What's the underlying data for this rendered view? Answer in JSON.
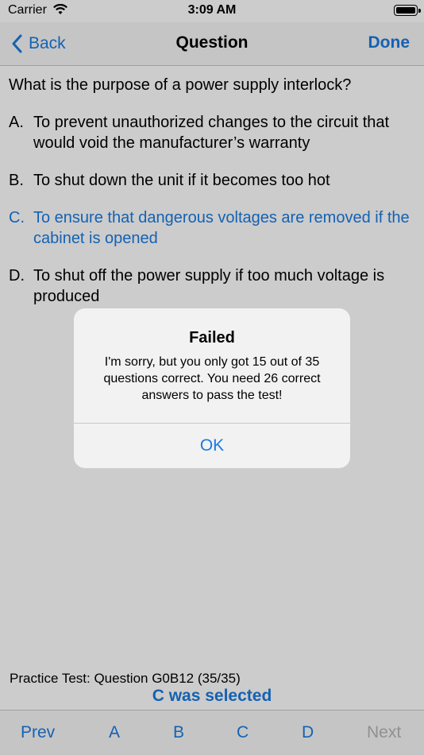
{
  "status": {
    "carrier": "Carrier",
    "time": "3:09 AM"
  },
  "nav": {
    "back_label": "Back",
    "title": "Question",
    "done_label": "Done"
  },
  "question": "What is the purpose of a power supply interlock?",
  "answers": [
    {
      "letter": "A.",
      "text": "To prevent unauthorized changes to the circuit that would void the manufacturer’s warranty"
    },
    {
      "letter": "B.",
      "text": "To shut down the unit if it becomes too hot"
    },
    {
      "letter": "C.",
      "text": "To ensure that dangerous voltages are removed if the cabinet is opened"
    },
    {
      "letter": "D.",
      "text": "To shut off the power supply if too much voltage is produced"
    }
  ],
  "footer": {
    "info": "Practice Test:  Question G0B12 (35/35)",
    "selected_msg": "C was selected"
  },
  "toolbar": {
    "prev": "Prev",
    "a": "A",
    "b": "B",
    "c": "C",
    "d": "D",
    "next": "Next"
  },
  "alert": {
    "title": "Failed",
    "message": "I'm sorry, but you only got 15 out of 35 questions correct.  You need 26 correct answers to pass the test!",
    "ok_label": "OK"
  },
  "colors": {
    "accent": "#1a7be0",
    "disabled": "#b5b5b5"
  }
}
